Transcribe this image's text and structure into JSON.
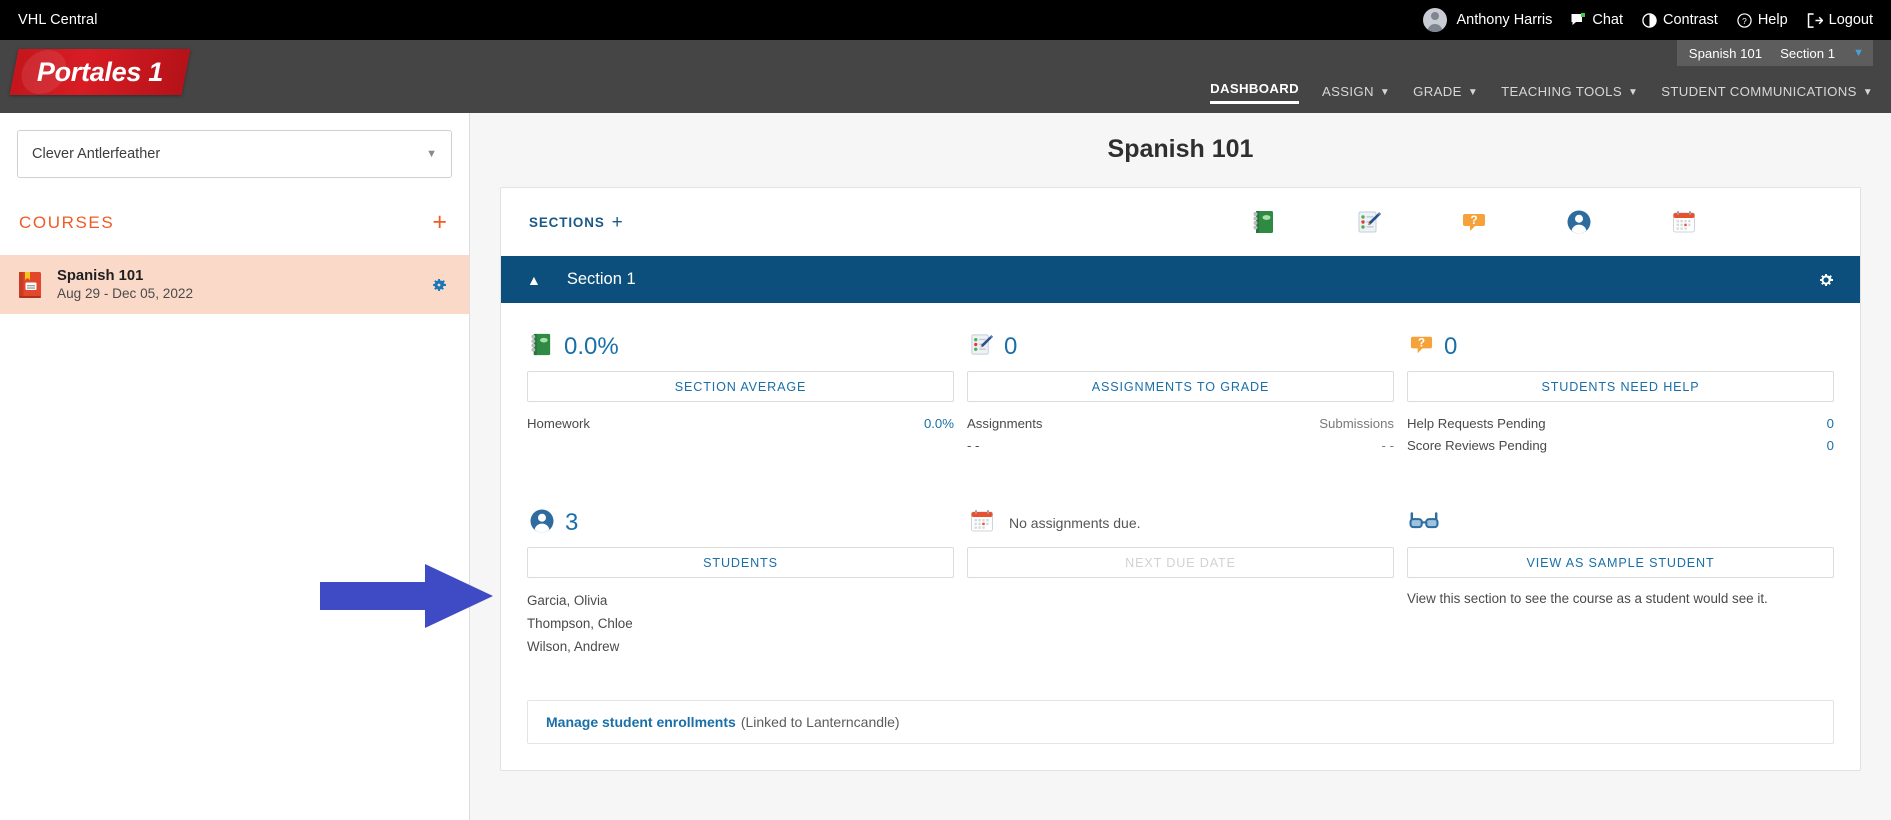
{
  "topbar": {
    "brand": "VHL Central",
    "user_name": "Anthony Harris",
    "chat_label": "Chat",
    "contrast_label": "Contrast",
    "help_label": "Help",
    "logout_label": "Logout"
  },
  "header": {
    "logo_text": "Portales 1",
    "course_picker": {
      "course": "Spanish 101",
      "section": "Section 1"
    },
    "nav": [
      {
        "label": "DASHBOARD",
        "active": true,
        "caret": false
      },
      {
        "label": "ASSIGN",
        "active": false,
        "caret": true
      },
      {
        "label": "GRADE",
        "active": false,
        "caret": true
      },
      {
        "label": "TEACHING TOOLS",
        "active": false,
        "caret": true
      },
      {
        "label": "STUDENT COMMUNICATIONS",
        "active": false,
        "caret": true
      }
    ]
  },
  "sidebar": {
    "school_select": "Clever Antlerfeather",
    "courses_title": "COURSES",
    "add_course_label": "+",
    "course": {
      "name": "Spanish 101",
      "dates": "Aug 29 - Dec 05, 2022"
    }
  },
  "main": {
    "page_title": "Spanish 101",
    "sections_label": "SECTIONS",
    "sections_add": "+",
    "section_icons": [
      "gradebook-icon",
      "assignments-icon",
      "help-requests-icon",
      "students-icon",
      "calendar-icon"
    ],
    "section": {
      "title": "Section 1",
      "collapse_icon": "chevron-up-icon",
      "gear_icon": "gear-icon"
    },
    "stats_row1": [
      {
        "icon": "gradebook-icon",
        "value": "0.0%",
        "button": "SECTION AVERAGE",
        "rows": [
          {
            "label": "Homework",
            "value": "0.0%"
          }
        ]
      },
      {
        "icon": "assignments-icon",
        "value": "0",
        "button": "ASSIGNMENTS TO GRADE",
        "rows": [
          {
            "label": "Assignments",
            "value": "Submissions"
          },
          {
            "label": "- -",
            "value": "- -"
          }
        ]
      },
      {
        "icon": "help-requests-icon",
        "value": "0",
        "button": "STUDENTS NEED HELP",
        "rows": [
          {
            "label": "Help Requests Pending",
            "value": "0"
          },
          {
            "label": "Score Reviews Pending",
            "value": "0"
          }
        ]
      }
    ],
    "stats_row2": [
      {
        "icon": "students-icon",
        "value": "3",
        "button": "STUDENTS",
        "students": [
          "Garcia, Olivia",
          "Thompson, Chloe",
          "Wilson, Andrew"
        ]
      },
      {
        "icon": "calendar-icon",
        "note": "No assignments due.",
        "button": "NEXT DUE DATE",
        "button_disabled": true
      },
      {
        "icon": "glasses-icon",
        "button": "VIEW AS SAMPLE STUDENT",
        "description": "View this section to see the course as a student would see it."
      }
    ],
    "enrollment": {
      "link": "Manage student enrollments",
      "suffix": "(Linked to Lanterncandle)"
    }
  },
  "annotation": {
    "arrow_color": "#3f4bc4",
    "arrow_direction": "right",
    "points_at": "STUDENTS"
  },
  "colors": {
    "topbar_bg": "#000000",
    "header_bg": "#454545",
    "logo_red": "#c4161c",
    "accent_orange": "#ef5b25",
    "section_blue": "#0d4f7c",
    "link_blue": "#1a6fa8",
    "course_highlight": "#fbd9c8"
  }
}
